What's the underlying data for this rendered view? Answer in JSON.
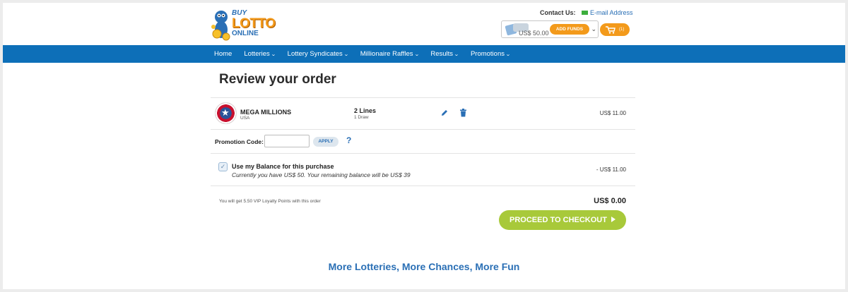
{
  "header": {
    "logo": {
      "line1": "BUY",
      "line2": "LOTTO",
      "line3": "ONLINE"
    },
    "contact_label": "Contact Us:",
    "email_link": "E-mail Address",
    "balance": "US$ 50.00",
    "add_funds_label": "ADD FUNDS",
    "cart_count": "(1)"
  },
  "nav": {
    "items": [
      {
        "label": "Home",
        "has_dropdown": false
      },
      {
        "label": "Lotteries",
        "has_dropdown": true
      },
      {
        "label": "Lottery Syndicates",
        "has_dropdown": true
      },
      {
        "label": "Millionaire Raffles",
        "has_dropdown": true
      },
      {
        "label": "Results",
        "has_dropdown": true
      },
      {
        "label": "Promotions",
        "has_dropdown": true
      }
    ]
  },
  "page_title": "Review your order",
  "order": {
    "lottery_name": "MEGA MILLIONS",
    "country": "USA",
    "lines": "2 Lines",
    "draws": "1 Draw",
    "price": "US$ 11.00"
  },
  "promo": {
    "label": "Promotion Code:",
    "value": "",
    "apply_label": "APPLY",
    "help": "?"
  },
  "balance_option": {
    "checked": true,
    "title": "Use my Balance for this purchase",
    "subtitle": "Currently you have US$ 50. Your remaining balance will be US$ 39",
    "deduction": "- US$ 11.00"
  },
  "summary": {
    "loyalty_text": "You will get 5.50 VIP Loyalty Points with this order",
    "total": "US$ 0.00",
    "checkout_label": "PROCEED TO CHECKOUT"
  },
  "tagline": "More Lotteries, More Chances, More Fun",
  "colors": {
    "brand_blue": "#0d6fb8",
    "accent_orange": "#f39a1b",
    "checkout_green": "#a8c93a",
    "link_blue": "#2a6fb5"
  }
}
